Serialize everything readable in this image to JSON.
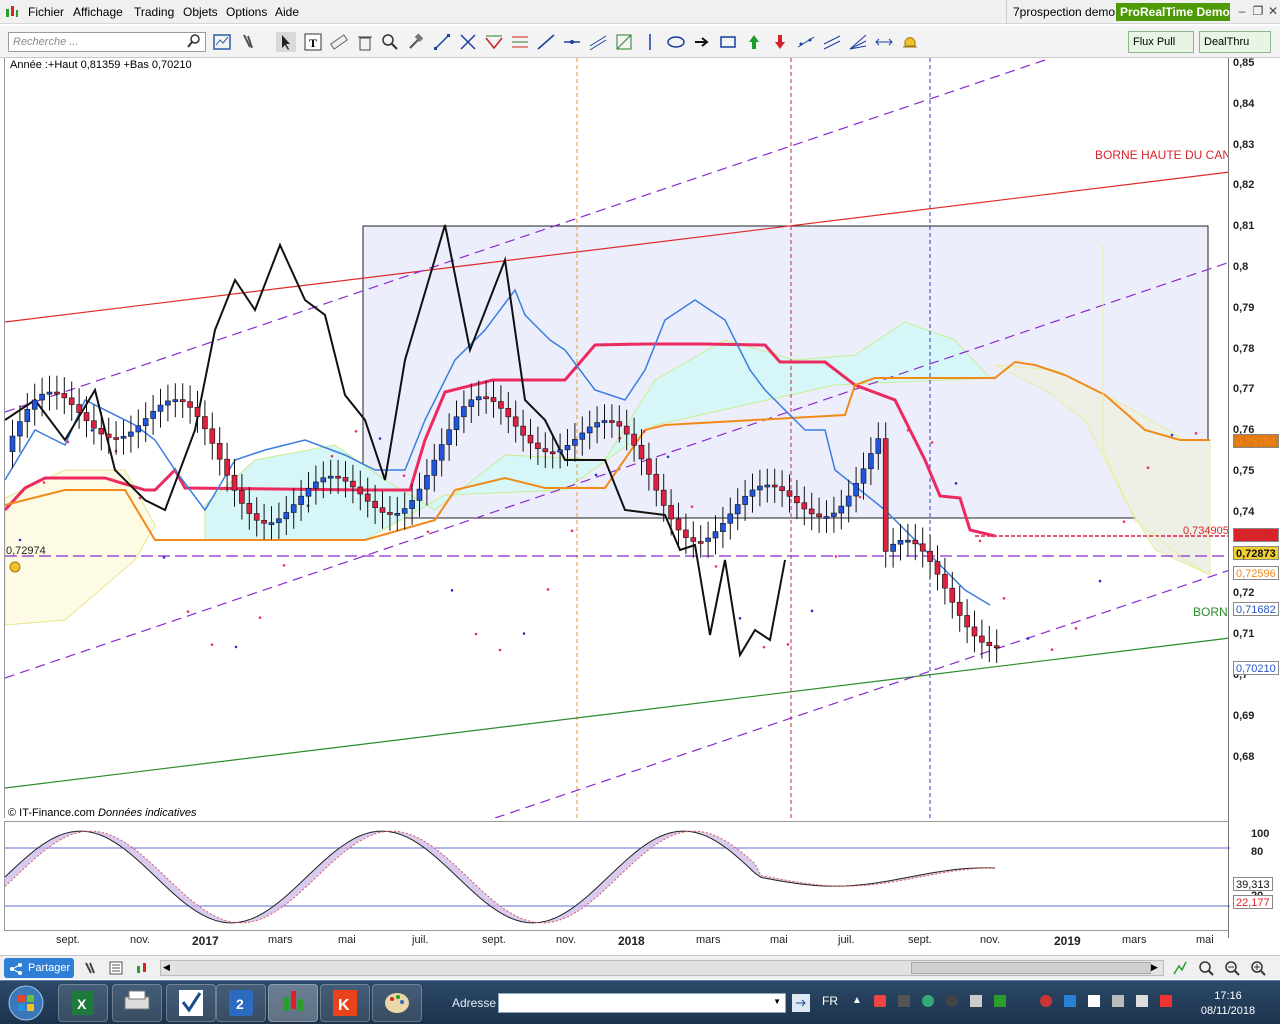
{
  "menubar": {
    "items": [
      "Fichier",
      "Affichage",
      "Trading",
      "Objets",
      "Options",
      "Aide"
    ],
    "account": "7prospection demo",
    "brand": "ProRealTime",
    "brand_suffix": "Demo"
  },
  "toolbar": {
    "search_placeholder": "Recherche ...",
    "flux_pull": "Flux Pull",
    "dealthru": "DealThru"
  },
  "chart": {
    "info": "Année :+Haut 0,81359 +Bas 0,70210",
    "credits_company": "© IT-Finance.com",
    "credits_note": "Données indicatives",
    "label_borne_haute": "BORNE HAUTE DU CAN",
    "label_borne": "BORN",
    "level_left": "0,72974",
    "level_red": "0,734905",
    "accent_up": "#2255dd",
    "accent_down": "#e02040"
  },
  "yaxis": {
    "ticks": [
      "0,85",
      "0,84",
      "0,83",
      "0,82",
      "0,81",
      "0,8",
      "0,79",
      "0,78",
      "0,77",
      "0,76",
      "0,75",
      "0,74",
      "0,73",
      "0,72",
      "0,71",
      "0,7",
      "0,69",
      "0,68"
    ],
    "badges": {
      "b1": "0,75784",
      "b2": "0,73490",
      "b3": "0,72873",
      "b4": "0,72596",
      "b5": "0,71682",
      "b6": "0,70210"
    }
  },
  "oscillator": {
    "ticks": [
      "100",
      "80",
      "20"
    ],
    "value1": "39,313",
    "value2": "22,177"
  },
  "xaxis": {
    "labels": [
      "sept.",
      "nov.",
      "2017",
      "mars",
      "mai",
      "juil.",
      "sept.",
      "nov.",
      "2018",
      "mars",
      "mai",
      "juil.",
      "sept.",
      "nov.",
      "2019",
      "mars",
      "mai"
    ]
  },
  "bottombar": {
    "share": "Partager"
  },
  "taskbar": {
    "address_label": "Adresse",
    "lang": "FR",
    "time": "17:16",
    "date": "08/11/2018"
  }
}
